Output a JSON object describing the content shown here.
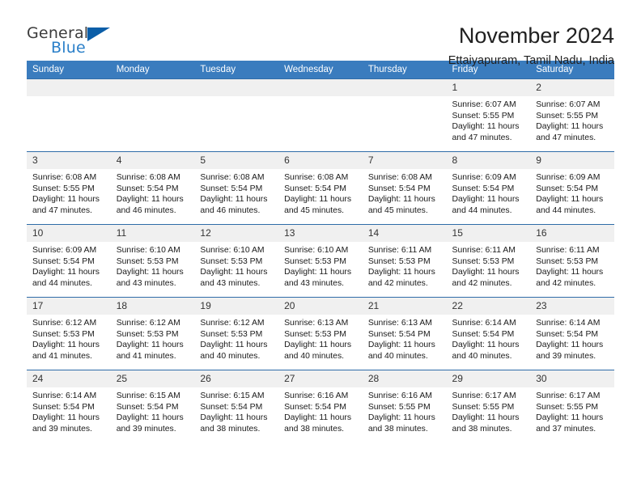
{
  "brand": {
    "name_part1": "General",
    "name_part2": "Blue",
    "flag_icon": "triangle-flag-icon"
  },
  "header": {
    "month_title": "November 2024",
    "location": "Ettaiyapuram, Tamil Nadu, India"
  },
  "theme": {
    "header_blue": "#3a7cbe",
    "row_border_blue": "#2f6ca8",
    "daynum_bg": "#f0f0f0",
    "brand_blue": "#2a7fc9",
    "brand_dark": "#3c3c3c"
  },
  "calendar": {
    "weekday_headers": [
      "Sunday",
      "Monday",
      "Tuesday",
      "Wednesday",
      "Thursday",
      "Friday",
      "Saturday"
    ],
    "weeks": [
      [
        {
          "day": "",
          "lines": []
        },
        {
          "day": "",
          "lines": []
        },
        {
          "day": "",
          "lines": []
        },
        {
          "day": "",
          "lines": []
        },
        {
          "day": "",
          "lines": []
        },
        {
          "day": "1",
          "lines": [
            "Sunrise: 6:07 AM",
            "Sunset: 5:55 PM",
            "Daylight: 11 hours",
            "and 47 minutes."
          ]
        },
        {
          "day": "2",
          "lines": [
            "Sunrise: 6:07 AM",
            "Sunset: 5:55 PM",
            "Daylight: 11 hours",
            "and 47 minutes."
          ]
        }
      ],
      [
        {
          "day": "3",
          "lines": [
            "Sunrise: 6:08 AM",
            "Sunset: 5:55 PM",
            "Daylight: 11 hours",
            "and 47 minutes."
          ]
        },
        {
          "day": "4",
          "lines": [
            "Sunrise: 6:08 AM",
            "Sunset: 5:54 PM",
            "Daylight: 11 hours",
            "and 46 minutes."
          ]
        },
        {
          "day": "5",
          "lines": [
            "Sunrise: 6:08 AM",
            "Sunset: 5:54 PM",
            "Daylight: 11 hours",
            "and 46 minutes."
          ]
        },
        {
          "day": "6",
          "lines": [
            "Sunrise: 6:08 AM",
            "Sunset: 5:54 PM",
            "Daylight: 11 hours",
            "and 45 minutes."
          ]
        },
        {
          "day": "7",
          "lines": [
            "Sunrise: 6:08 AM",
            "Sunset: 5:54 PM",
            "Daylight: 11 hours",
            "and 45 minutes."
          ]
        },
        {
          "day": "8",
          "lines": [
            "Sunrise: 6:09 AM",
            "Sunset: 5:54 PM",
            "Daylight: 11 hours",
            "and 44 minutes."
          ]
        },
        {
          "day": "9",
          "lines": [
            "Sunrise: 6:09 AM",
            "Sunset: 5:54 PM",
            "Daylight: 11 hours",
            "and 44 minutes."
          ]
        }
      ],
      [
        {
          "day": "10",
          "lines": [
            "Sunrise: 6:09 AM",
            "Sunset: 5:54 PM",
            "Daylight: 11 hours",
            "and 44 minutes."
          ]
        },
        {
          "day": "11",
          "lines": [
            "Sunrise: 6:10 AM",
            "Sunset: 5:53 PM",
            "Daylight: 11 hours",
            "and 43 minutes."
          ]
        },
        {
          "day": "12",
          "lines": [
            "Sunrise: 6:10 AM",
            "Sunset: 5:53 PM",
            "Daylight: 11 hours",
            "and 43 minutes."
          ]
        },
        {
          "day": "13",
          "lines": [
            "Sunrise: 6:10 AM",
            "Sunset: 5:53 PM",
            "Daylight: 11 hours",
            "and 43 minutes."
          ]
        },
        {
          "day": "14",
          "lines": [
            "Sunrise: 6:11 AM",
            "Sunset: 5:53 PM",
            "Daylight: 11 hours",
            "and 42 minutes."
          ]
        },
        {
          "day": "15",
          "lines": [
            "Sunrise: 6:11 AM",
            "Sunset: 5:53 PM",
            "Daylight: 11 hours",
            "and 42 minutes."
          ]
        },
        {
          "day": "16",
          "lines": [
            "Sunrise: 6:11 AM",
            "Sunset: 5:53 PM",
            "Daylight: 11 hours",
            "and 42 minutes."
          ]
        }
      ],
      [
        {
          "day": "17",
          "lines": [
            "Sunrise: 6:12 AM",
            "Sunset: 5:53 PM",
            "Daylight: 11 hours",
            "and 41 minutes."
          ]
        },
        {
          "day": "18",
          "lines": [
            "Sunrise: 6:12 AM",
            "Sunset: 5:53 PM",
            "Daylight: 11 hours",
            "and 41 minutes."
          ]
        },
        {
          "day": "19",
          "lines": [
            "Sunrise: 6:12 AM",
            "Sunset: 5:53 PM",
            "Daylight: 11 hours",
            "and 40 minutes."
          ]
        },
        {
          "day": "20",
          "lines": [
            "Sunrise: 6:13 AM",
            "Sunset: 5:53 PM",
            "Daylight: 11 hours",
            "and 40 minutes."
          ]
        },
        {
          "day": "21",
          "lines": [
            "Sunrise: 6:13 AM",
            "Sunset: 5:54 PM",
            "Daylight: 11 hours",
            "and 40 minutes."
          ]
        },
        {
          "day": "22",
          "lines": [
            "Sunrise: 6:14 AM",
            "Sunset: 5:54 PM",
            "Daylight: 11 hours",
            "and 40 minutes."
          ]
        },
        {
          "day": "23",
          "lines": [
            "Sunrise: 6:14 AM",
            "Sunset: 5:54 PM",
            "Daylight: 11 hours",
            "and 39 minutes."
          ]
        }
      ],
      [
        {
          "day": "24",
          "lines": [
            "Sunrise: 6:14 AM",
            "Sunset: 5:54 PM",
            "Daylight: 11 hours",
            "and 39 minutes."
          ]
        },
        {
          "day": "25",
          "lines": [
            "Sunrise: 6:15 AM",
            "Sunset: 5:54 PM",
            "Daylight: 11 hours",
            "and 39 minutes."
          ]
        },
        {
          "day": "26",
          "lines": [
            "Sunrise: 6:15 AM",
            "Sunset: 5:54 PM",
            "Daylight: 11 hours",
            "and 38 minutes."
          ]
        },
        {
          "day": "27",
          "lines": [
            "Sunrise: 6:16 AM",
            "Sunset: 5:54 PM",
            "Daylight: 11 hours",
            "and 38 minutes."
          ]
        },
        {
          "day": "28",
          "lines": [
            "Sunrise: 6:16 AM",
            "Sunset: 5:55 PM",
            "Daylight: 11 hours",
            "and 38 minutes."
          ]
        },
        {
          "day": "29",
          "lines": [
            "Sunrise: 6:17 AM",
            "Sunset: 5:55 PM",
            "Daylight: 11 hours",
            "and 38 minutes."
          ]
        },
        {
          "day": "30",
          "lines": [
            "Sunrise: 6:17 AM",
            "Sunset: 5:55 PM",
            "Daylight: 11 hours",
            "and 37 minutes."
          ]
        }
      ]
    ]
  }
}
